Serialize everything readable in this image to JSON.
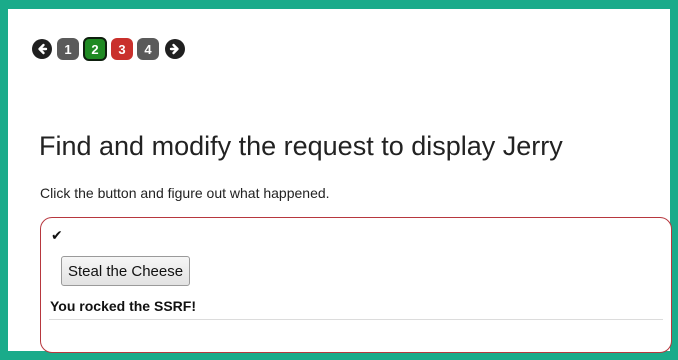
{
  "pager": {
    "prev_icon": "arrow-left-circle-icon",
    "next_icon": "arrow-right-circle-icon",
    "pages": [
      {
        "label": "1",
        "status": "gray",
        "color": "#5a5a5a"
      },
      {
        "label": "2",
        "status": "current-success",
        "color": "#1f8a22"
      },
      {
        "label": "3",
        "status": "failed",
        "color": "#c9302c"
      },
      {
        "label": "4",
        "status": "gray",
        "color": "#5a5a5a"
      }
    ]
  },
  "lesson": {
    "title": "Find and modify the request to display Jerry",
    "instructions": "Click the button and figure out what happened."
  },
  "attack": {
    "status_icon": "checkmark-icon",
    "button_label": "Steal the Cheese",
    "result_message": "You rocked the SSRF!"
  },
  "colors": {
    "frame": "#1aab8a",
    "panel_border": "#b7373e"
  }
}
